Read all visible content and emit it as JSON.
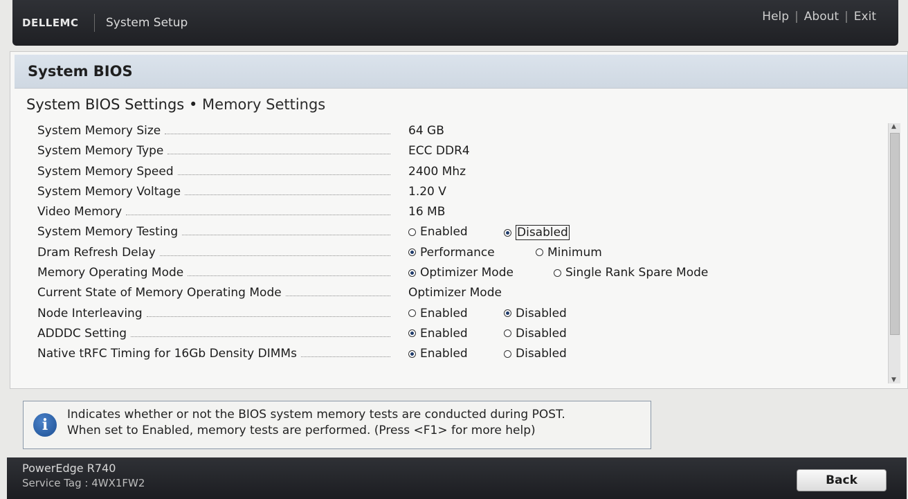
{
  "header": {
    "brand": "DELLEMC",
    "app_title": "System Setup",
    "links": [
      "Help",
      "About",
      "Exit"
    ],
    "link_separator": "|"
  },
  "section": {
    "title": "System BIOS"
  },
  "breadcrumb": {
    "parent": "System BIOS Settings",
    "separator": "•",
    "current": "Memory Settings"
  },
  "settings": {
    "mem_size": {
      "label": "System Memory Size",
      "value": "64 GB"
    },
    "mem_type": {
      "label": "System Memory Type",
      "value": "ECC DDR4"
    },
    "mem_speed": {
      "label": "System Memory Speed",
      "value": "2400 Mhz"
    },
    "mem_voltage": {
      "label": "System Memory Voltage",
      "value": "1.20 V"
    },
    "video_mem": {
      "label": "Video Memory",
      "value": "16 MB"
    },
    "mem_testing": {
      "label": "System Memory Testing",
      "options": [
        "Enabled",
        "Disabled"
      ],
      "selected": "Disabled"
    },
    "dram_refresh": {
      "label": "Dram Refresh Delay",
      "options": [
        "Performance",
        "Minimum"
      ],
      "selected": "Performance"
    },
    "mem_op_mode": {
      "label": "Memory Operating Mode",
      "options": [
        "Optimizer Mode",
        "Single Rank Spare Mode"
      ],
      "selected": "Optimizer Mode"
    },
    "cur_mem_op_mode": {
      "label": "Current State of Memory Operating Mode",
      "value": "Optimizer Mode"
    },
    "node_interleave": {
      "label": "Node Interleaving",
      "options": [
        "Enabled",
        "Disabled"
      ],
      "selected": "Disabled"
    },
    "adddc": {
      "label": "ADDDC Setting",
      "options": [
        "Enabled",
        "Disabled"
      ],
      "selected": "Enabled"
    },
    "native_trfc": {
      "label": "Native tRFC Timing for 16Gb Density DIMMs",
      "options": [
        "Enabled",
        "Disabled"
      ],
      "selected": "Enabled"
    }
  },
  "help": {
    "icon": "info-icon",
    "line1": "Indicates whether or not the BIOS system memory tests are conducted during POST.",
    "line2": "When set to Enabled, memory tests are performed. (Press <F1> for more help)"
  },
  "footer": {
    "model": "PowerEdge R740",
    "service_tag": "Service Tag : 4WX1FW2",
    "back_label": "Back"
  }
}
